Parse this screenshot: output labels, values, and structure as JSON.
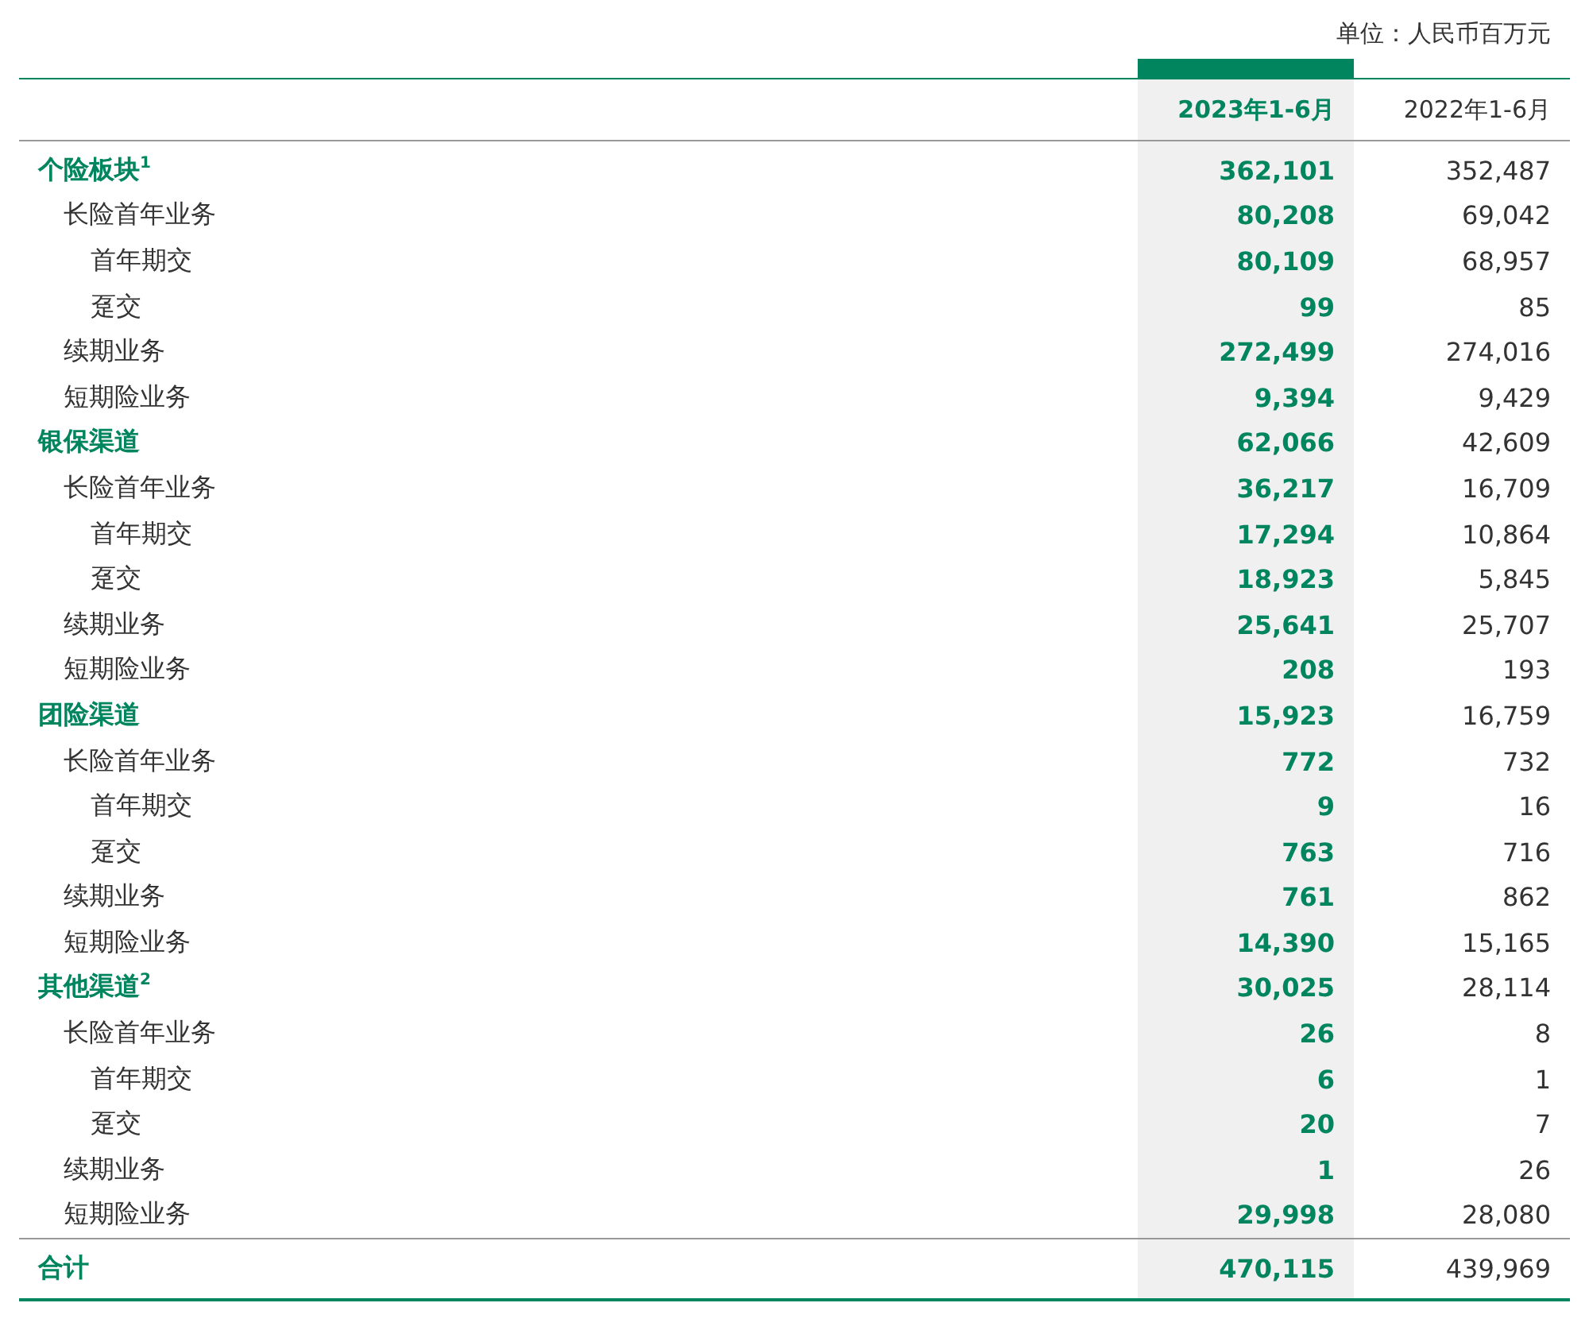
{
  "unit": "单位：人民币百万元",
  "columns": [
    {
      "label": "2023年1-6月",
      "kind": "current"
    },
    {
      "label": "2022年1-6月",
      "kind": "prior"
    }
  ],
  "rows": [
    {
      "kind": "section",
      "label": "个险板块$^{1}$",
      "values": [
        "362,101",
        "352,487"
      ]
    },
    {
      "kind": "item",
      "label": "长险首年业务",
      "values": [
        "80,208",
        "69,042"
      ]
    },
    {
      "kind": "subitem",
      "label": "首年期交",
      "values": [
        "80,109",
        "68,957"
      ]
    },
    {
      "kind": "subitem",
      "label": "趸交",
      "values": [
        "99",
        "85"
      ]
    },
    {
      "kind": "item",
      "label": "续期业务",
      "values": [
        "272,499",
        "274,016"
      ]
    },
    {
      "kind": "item",
      "label": "短期险业务",
      "values": [
        "9,394",
        "9,429"
      ]
    },
    {
      "kind": "section",
      "label": "银保渠道",
      "values": [
        "62,066",
        "42,609"
      ]
    },
    {
      "kind": "item",
      "label": "长险首年业务",
      "values": [
        "36,217",
        "16,709"
      ]
    },
    {
      "kind": "subitem",
      "label": "首年期交",
      "values": [
        "17,294",
        "10,864"
      ]
    },
    {
      "kind": "subitem",
      "label": "趸交",
      "values": [
        "18,923",
        "5,845"
      ]
    },
    {
      "kind": "item",
      "label": "续期业务",
      "values": [
        "25,641",
        "25,707"
      ]
    },
    {
      "kind": "item",
      "label": "短期险业务",
      "values": [
        "208",
        "193"
      ]
    },
    {
      "kind": "section",
      "label": "团险渠道",
      "values": [
        "15,923",
        "16,759"
      ]
    },
    {
      "kind": "item",
      "label": "长险首年业务",
      "values": [
        "772",
        "732"
      ]
    },
    {
      "kind": "subitem",
      "label": "首年期交",
      "values": [
        "9",
        "16"
      ]
    },
    {
      "kind": "subitem",
      "label": "趸交",
      "values": [
        "763",
        "716"
      ]
    },
    {
      "kind": "item",
      "label": "续期业务",
      "values": [
        "761",
        "862"
      ]
    },
    {
      "kind": "item",
      "label": "短期险业务",
      "values": [
        "14,390",
        "15,165"
      ]
    },
    {
      "kind": "section",
      "label": "其他渠道$^{2}$",
      "values": [
        "30,025",
        "28,114"
      ]
    },
    {
      "kind": "item",
      "label": "长险首年业务",
      "values": [
        "26",
        "8"
      ]
    },
    {
      "kind": "subitem",
      "label": "首年期交",
      "values": [
        "6",
        "1"
      ]
    },
    {
      "kind": "subitem",
      "label": "趸交",
      "values": [
        "20",
        "7"
      ]
    },
    {
      "kind": "item",
      "label": "续期业务",
      "values": [
        "1",
        "26"
      ]
    },
    {
      "kind": "item",
      "label": "短期险业务",
      "values": [
        "29,998",
        "28,080"
      ]
    },
    {
      "kind": "total",
      "label": "合计",
      "values": [
        "470,115",
        "439,969"
      ]
    }
  ]
}
